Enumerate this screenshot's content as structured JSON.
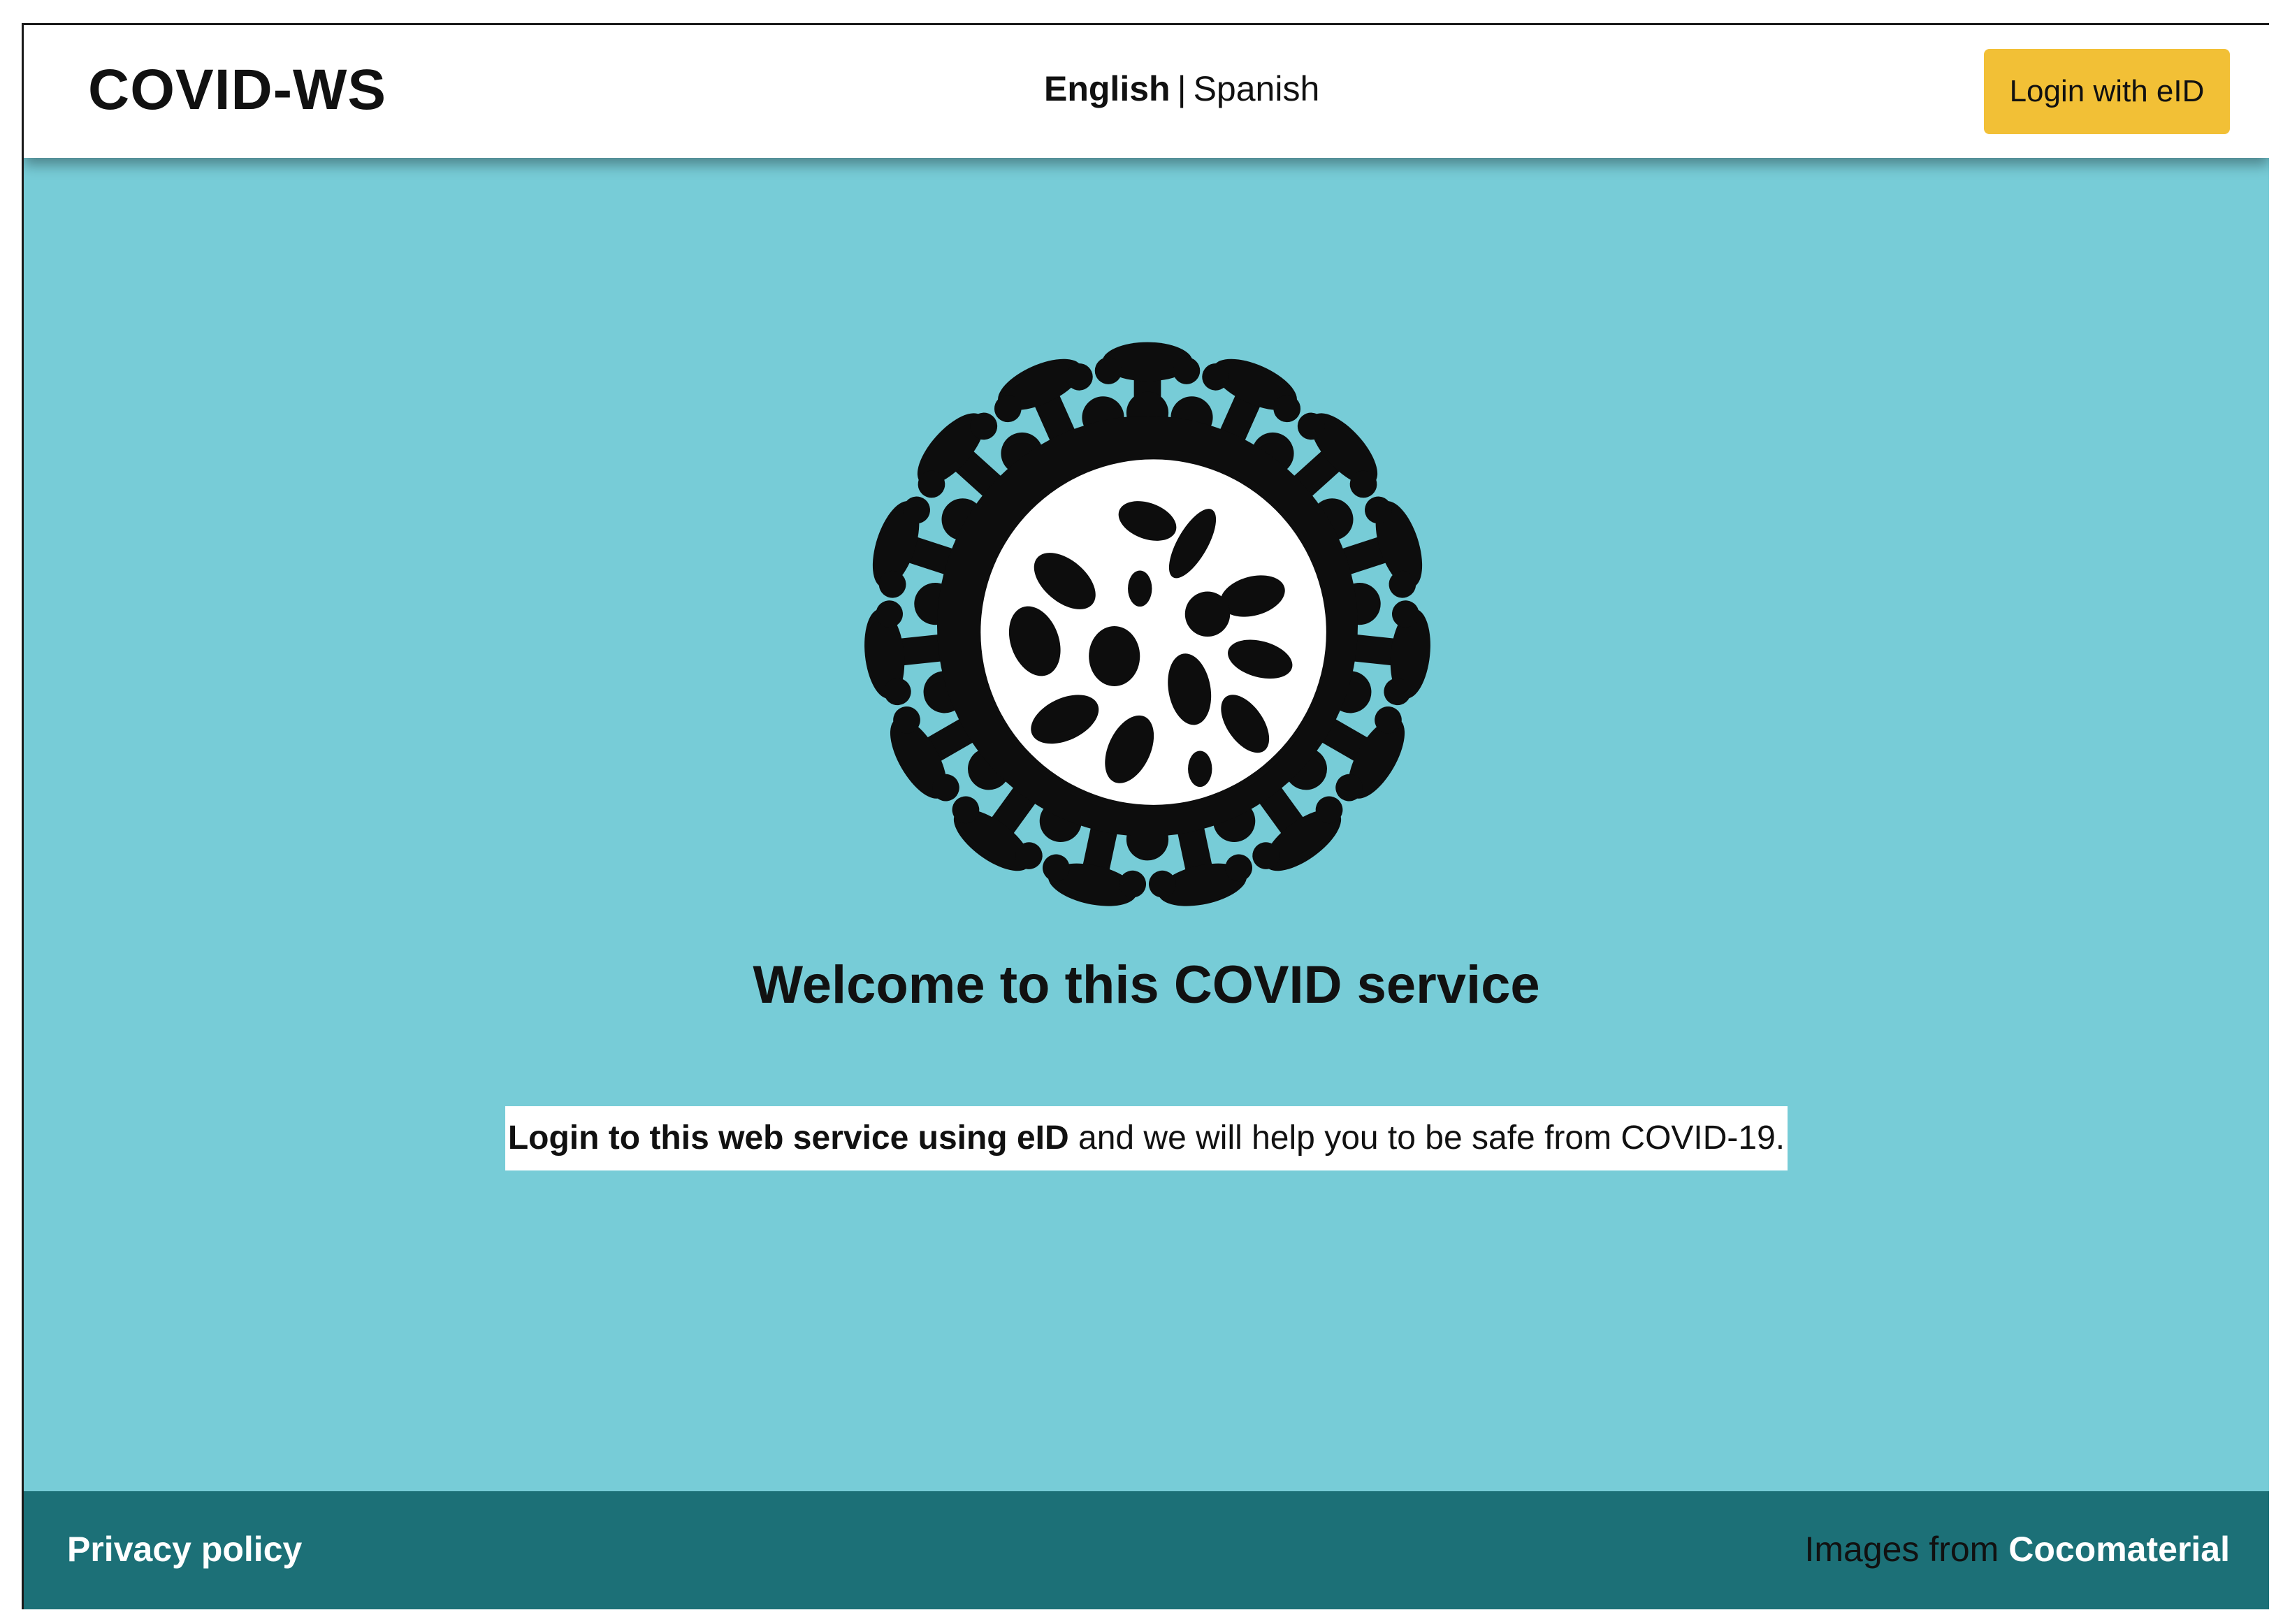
{
  "header": {
    "brand": "COVID-WS",
    "languages": {
      "active": "English",
      "separator": "|",
      "other": "Spanish"
    },
    "login_button": "Login with eID"
  },
  "main": {
    "illustration": "coronavirus-icon",
    "welcome_title": "Welcome to this COVID service",
    "tagline_bold": "Login to this web service using eID",
    "tagline_rest": " and we will help you to be safe from COVID-19."
  },
  "footer": {
    "privacy_link": "Privacy policy",
    "credits_prefix": "Images from ",
    "credits_link": "Cocomaterial"
  },
  "colors": {
    "header_bg": "#ffffff",
    "main_bg": "#77ccd7",
    "footer_bg": "#1c7077",
    "button_bg": "#f2c036"
  }
}
